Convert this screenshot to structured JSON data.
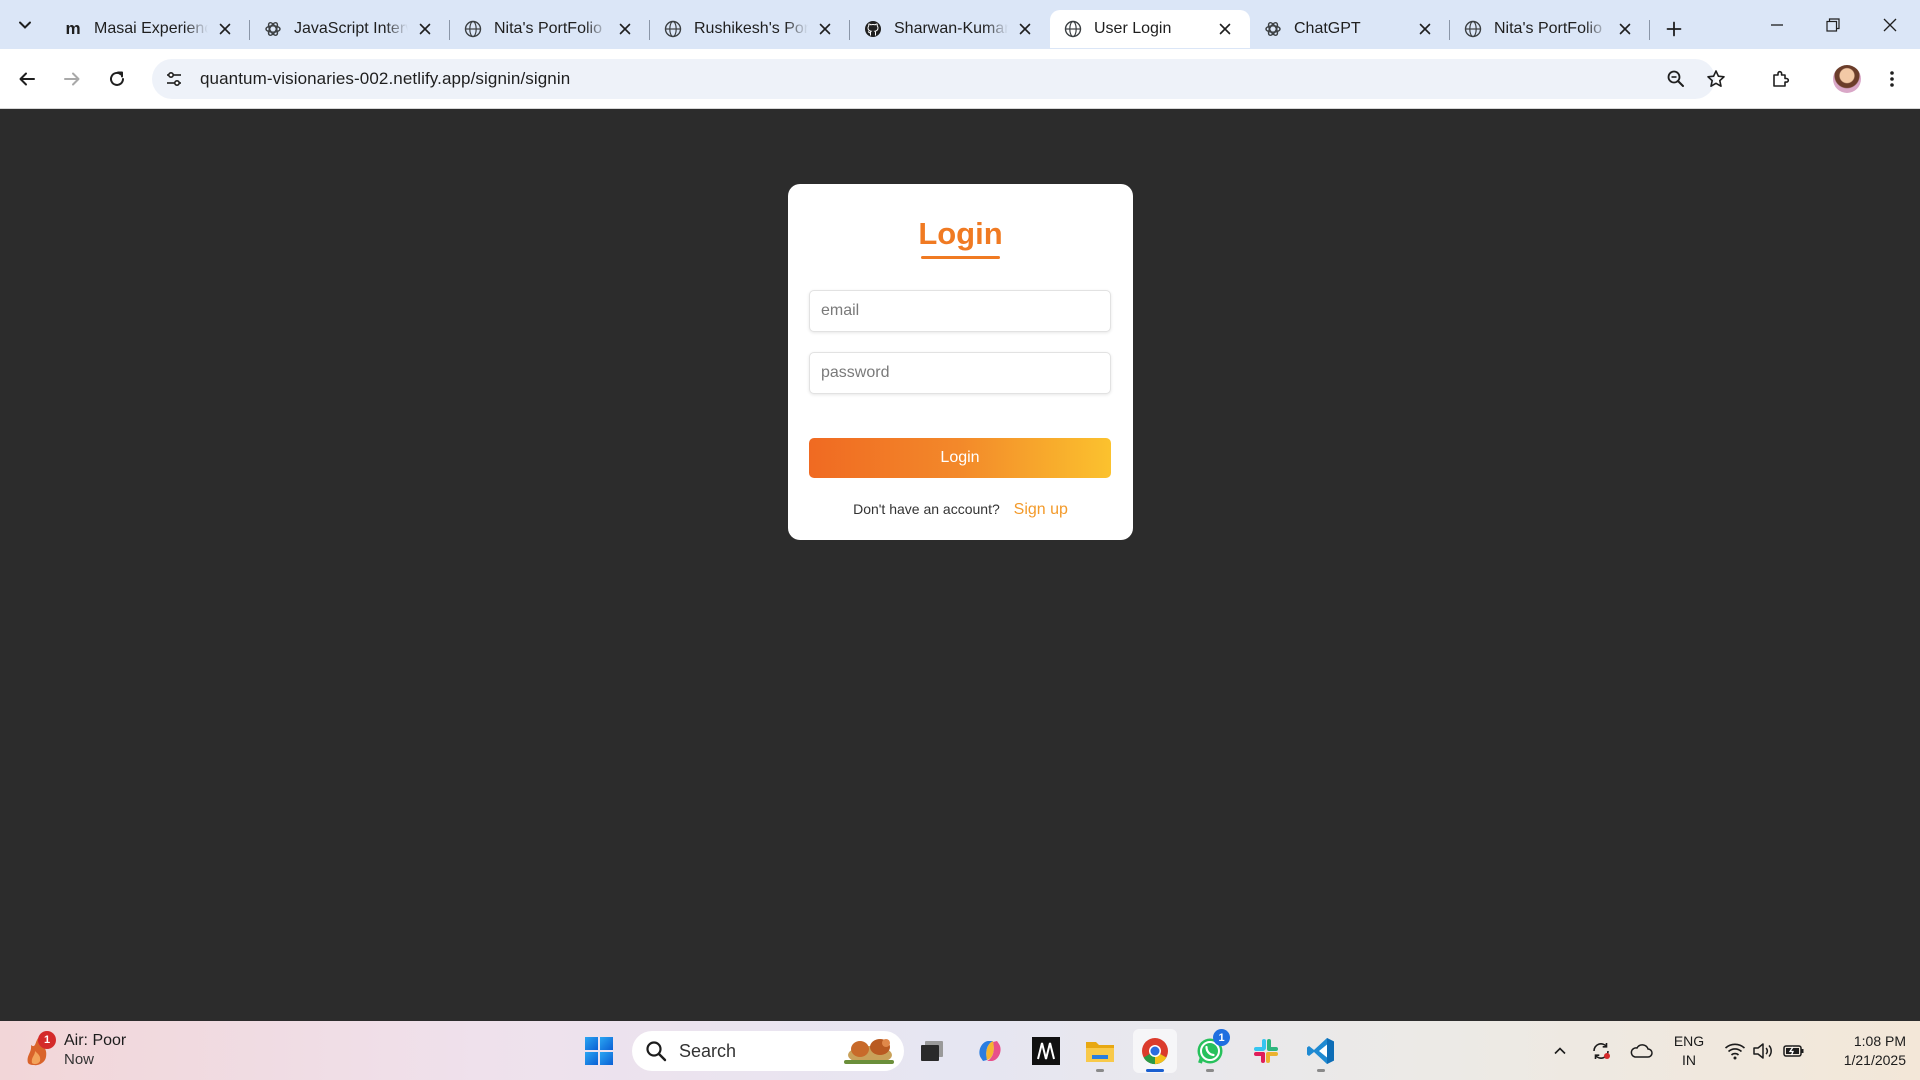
{
  "browser": {
    "tabs": [
      {
        "title": "Masai Experience",
        "favicon": "masai-icon",
        "favicon_letter": "m",
        "active": false
      },
      {
        "title": "JavaScript Interview",
        "favicon": "chatgpt-icon",
        "active": false
      },
      {
        "title": "Nita's PortFolio",
        "favicon": "globe-icon",
        "active": false
      },
      {
        "title": "Rushikesh's Portfolio",
        "favicon": "globe-icon",
        "active": false
      },
      {
        "title": "Sharwan-Kumar",
        "favicon": "github-icon",
        "active": false
      },
      {
        "title": "User Login",
        "favicon": "globe-icon",
        "active": true
      },
      {
        "title": "ChatGPT",
        "favicon": "chatgpt-icon",
        "active": false
      },
      {
        "title": "Nita's PortFolio",
        "favicon": "globe-icon",
        "active": false
      }
    ],
    "url": "quantum-visionaries-002.netlify.app/signin/signin"
  },
  "login_card": {
    "title": "Login",
    "email_placeholder": "email",
    "password_placeholder": "password",
    "button_label": "Login",
    "signup_prompt": "Don't have an account?",
    "signup_link": "Sign up"
  },
  "colors": {
    "page_background": "#2c2c2c",
    "accent_orange": "#f07a22",
    "button_gradient_start": "#f06a22",
    "button_gradient_end": "#fbc22e",
    "signup_link": "#f39a2a"
  },
  "taskbar": {
    "weather_title": "Air: Poor",
    "weather_subtitle": "Now",
    "weather_badge": "1",
    "search_label": "Search",
    "whatsapp_badge": "1",
    "language_line1": "ENG",
    "language_line2": "IN",
    "time": "1:08 PM",
    "date": "1/21/2025"
  }
}
